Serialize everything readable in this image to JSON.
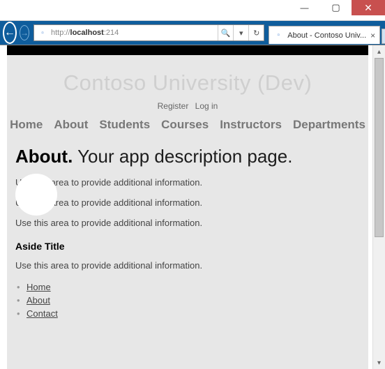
{
  "window": {
    "minimize": "—",
    "maximize": "▢",
    "close": "✕"
  },
  "address": {
    "prefix": "http://",
    "host": "localhost",
    "rest": ":214",
    "full_display": "http://localhost:214"
  },
  "tab": {
    "title": "About - Contoso Univ...",
    "close": "×"
  },
  "site": {
    "brand": "Contoso University (Dev)",
    "register": "Register",
    "login": "Log in",
    "menu": [
      "Home",
      "About",
      "Students",
      "Courses",
      "Instructors",
      "Departments"
    ]
  },
  "content": {
    "heading_bold": "About.",
    "heading_rest": " Your app description page.",
    "paragraphs": [
      "Use this area to provide additional information.",
      "Use this area to provide additional information.",
      "Use this area to provide additional information."
    ],
    "aside_title": "Aside Title",
    "aside_paragraph": "Use this area to provide additional information.",
    "links": [
      "Home",
      "About",
      "Contact"
    ]
  },
  "icons": {
    "back": "←",
    "forward": "→",
    "search": "🔍",
    "dropdown": "▾",
    "refresh": "↻",
    "home": "⌂",
    "star": "★",
    "gear": "⁝",
    "up": "▴",
    "down": "▾",
    "newtab": "▫",
    "page": "▫"
  }
}
